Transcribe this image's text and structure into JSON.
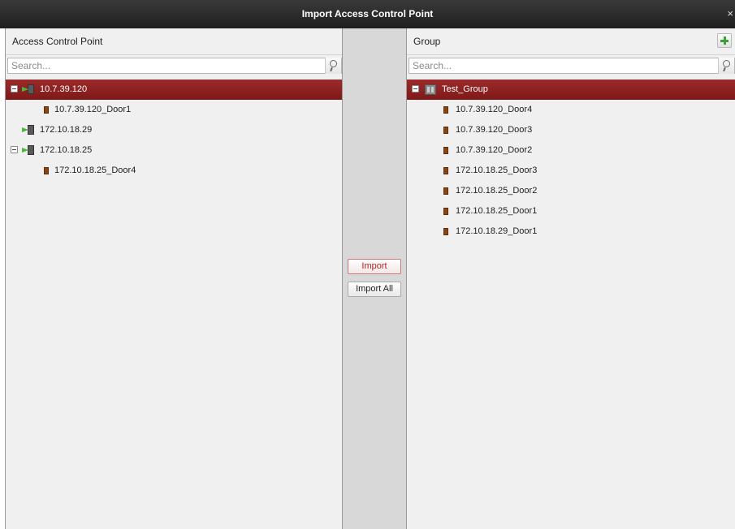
{
  "dialog": {
    "title": "Import Access Control Point",
    "close_label": "×"
  },
  "left": {
    "header": "Access Control Point",
    "search_placeholder": "Search...",
    "tree": [
      {
        "label": "10.7.39.120",
        "type": "device",
        "expanded": true,
        "selected": true
      },
      {
        "label": "10.7.39.120_Door1",
        "type": "door"
      },
      {
        "label": "172.10.18.29",
        "type": "device",
        "expanded": false
      },
      {
        "label": "172.10.18.25",
        "type": "device",
        "expanded": true
      },
      {
        "label": "172.10.18.25_Door4",
        "type": "door"
      }
    ]
  },
  "middle": {
    "import_label": "Import",
    "import_all_label": "Import All"
  },
  "right": {
    "header": "Group",
    "search_placeholder": "Search...",
    "tree": [
      {
        "label": "Test_Group",
        "type": "group",
        "expanded": true,
        "selected": true
      },
      {
        "label": "10.7.39.120_Door4",
        "type": "door"
      },
      {
        "label": "10.7.39.120_Door3",
        "type": "door"
      },
      {
        "label": "10.7.39.120_Door2",
        "type": "door"
      },
      {
        "label": "172.10.18.25_Door3",
        "type": "door"
      },
      {
        "label": "172.10.18.25_Door2",
        "type": "door"
      },
      {
        "label": "172.10.18.25_Door1",
        "type": "door"
      },
      {
        "label": "172.10.18.29_Door1",
        "type": "door"
      }
    ]
  },
  "colors": {
    "selection": "#8b1e1e",
    "title_bar": "#262626",
    "panel_bg": "#f0f0f0",
    "add_icon": "#3aa035",
    "door_icon": "#8b4513"
  }
}
